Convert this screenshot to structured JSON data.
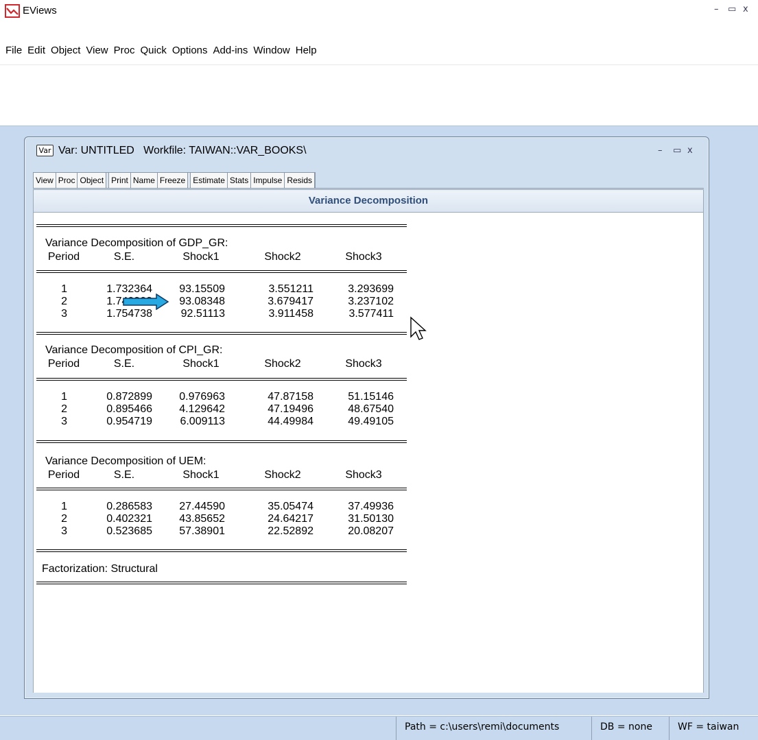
{
  "app": {
    "title": "EViews",
    "minimize": "–",
    "maximize": "▭",
    "close": "x"
  },
  "menu": [
    "File",
    "Edit",
    "Object",
    "View",
    "Proc",
    "Quick",
    "Options",
    "Add-ins",
    "Window",
    "Help"
  ],
  "var_window": {
    "icon_label": "Var",
    "title": "Var: UNTITLED   Workfile: TAIWAN::VAR_BOOKS\\",
    "minimize": "–",
    "maximize": "▭",
    "close": "x",
    "toolbar": {
      "group1": [
        "View",
        "Proc",
        "Object"
      ],
      "group2": [
        "Print",
        "Name",
        "Freeze"
      ],
      "group3": [
        "Estimate",
        "Stats",
        "Impulse",
        "Resids"
      ]
    },
    "header": "Variance Decomposition"
  },
  "table": {
    "col_headers": [
      "Period",
      "S.E.",
      "Shock1",
      "Shock2",
      "Shock3"
    ],
    "sections": [
      {
        "title": "Variance Decomposition of GDP_GR:",
        "rows": [
          [
            "1",
            "1.732364",
            "93.15509",
            "3.551211",
            "3.293699"
          ],
          [
            "2",
            "1.740303",
            "93.08348",
            "3.679417",
            "3.237102"
          ],
          [
            "3",
            "1.754738",
            "92.51113",
            "3.911458",
            "3.577411"
          ]
        ]
      },
      {
        "title": "Variance Decomposition of CPI_GR:",
        "rows": [
          [
            "1",
            "0.872899",
            "0.976963",
            "47.87158",
            "51.15146"
          ],
          [
            "2",
            "0.895466",
            "4.129642",
            "47.19496",
            "48.67540"
          ],
          [
            "3",
            "0.954719",
            "6.009113",
            "44.49984",
            "49.49105"
          ]
        ]
      },
      {
        "title": "Variance Decomposition of UEM:",
        "rows": [
          [
            "1",
            "0.286583",
            "27.44590",
            "35.05474",
            "37.49936"
          ],
          [
            "2",
            "0.402321",
            "43.85652",
            "24.64217",
            "31.50130"
          ],
          [
            "3",
            "0.523685",
            "57.38901",
            "22.52892",
            "20.08207"
          ]
        ]
      }
    ],
    "footer": "Factorization: Structural"
  },
  "status": {
    "path": "Path = c:\\users\\remi\\documents",
    "db": "DB = none",
    "wf": "WF = taiwan"
  },
  "colors": {
    "workspace": "#c6d9ee",
    "header_text": "#2f4f7a",
    "arrow": "#29a9e1"
  },
  "icons": [
    "eviews-logo-icon",
    "var-object-icon",
    "arrow-annotation-icon",
    "mouse-cursor-icon"
  ]
}
